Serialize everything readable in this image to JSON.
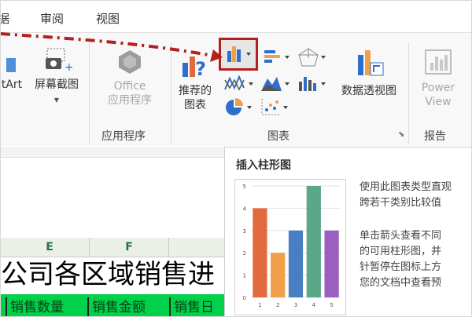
{
  "tabs": {
    "partial_left": "据",
    "review": "审阅",
    "view": "视图"
  },
  "ribbon": {
    "smartart_partial": "tArt",
    "screenshot": "屏幕截图",
    "office_line1": "Office",
    "office_line2": "应用程序",
    "recommended_line1": "推荐的",
    "recommended_line2": "图表",
    "pivot_chart": "数据透视图",
    "power_line1": "Power",
    "power_line2": "View",
    "groups": {
      "apps": "应用程序",
      "charts": "图表",
      "reports": "报告"
    }
  },
  "icons": [
    "bar-chart-icon",
    "horizontal-bar-icon",
    "radar-chart-icon",
    "line-chart-icon",
    "area-chart-icon",
    "stock-chart-icon",
    "pie-chart-icon",
    "scatter-chart-icon",
    "camera-icon",
    "office-apps-icon",
    "recommended-charts-icon",
    "pivot-chart-icon",
    "power-view-icon",
    "dialog-launcher-icon"
  ],
  "sheet": {
    "col_e": "E",
    "col_f": "F",
    "title_partial": "公司各区域销售进",
    "cells": [
      "销售数量",
      "销售金额",
      "销售日"
    ]
  },
  "tooltip": {
    "title": "插入柱形图",
    "line1": "使用此图表类型直观",
    "line2": "跨若干类别比较值",
    "line3": "单击箭头查看不同",
    "line4": "的可用柱形图，并",
    "line5": "针暂停在图标上方",
    "line6": "您的文档中查看预"
  },
  "chart_data": {
    "type": "bar",
    "categories": [
      "1",
      "2",
      "3",
      "4",
      "5"
    ],
    "values": [
      4,
      2,
      3,
      5,
      3
    ],
    "y_ticks": [
      "0",
      "1",
      "2",
      "3",
      "4",
      "5"
    ],
    "ylim": [
      0,
      5
    ],
    "colors": [
      "#e06a3d",
      "#f0a048",
      "#4a7ec2",
      "#5aa888",
      "#9b5fbf"
    ],
    "grid": true
  }
}
